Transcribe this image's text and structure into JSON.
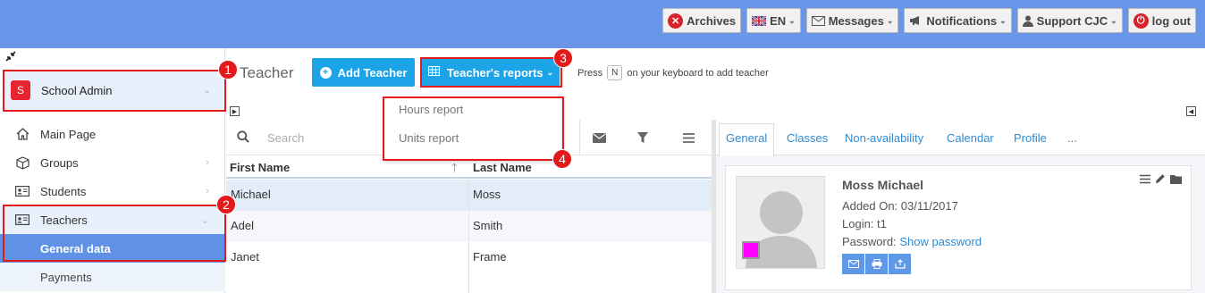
{
  "topbar": {
    "archives": "Archives",
    "language": "EN",
    "messages": "Messages",
    "notifications": "Notifications",
    "support": "Support CJC",
    "logout": "log out"
  },
  "sidebar": {
    "admin_initial": "S",
    "admin_name": "School Admin",
    "items": [
      {
        "label": "Main Page",
        "icon": "home-icon"
      },
      {
        "label": "Groups",
        "icon": "cube-icon"
      },
      {
        "label": "Students",
        "icon": "id-card-icon"
      },
      {
        "label": "Teachers",
        "icon": "id-card-icon"
      }
    ],
    "sub_items": [
      {
        "label": "General data"
      },
      {
        "label": "Payments"
      }
    ]
  },
  "header": {
    "title": "Teacher",
    "add_button": "Add Teacher",
    "reports_button": "Teacher's reports",
    "hint_prefix": "Press",
    "hint_key": "N",
    "hint_suffix": "on your keyboard to add teacher"
  },
  "dropdown": {
    "items": [
      "Hours report",
      "Units report"
    ]
  },
  "table": {
    "search_placeholder": "Search",
    "columns": [
      "First Name",
      "Last Name"
    ],
    "rows": [
      {
        "first": "Michael",
        "last": "Moss"
      },
      {
        "first": "Adel",
        "last": "Smith"
      },
      {
        "first": "Janet",
        "last": "Frame"
      }
    ]
  },
  "detail": {
    "tabs": [
      "General",
      "Classes",
      "Non-availability",
      "Calendar",
      "Profile",
      "..."
    ],
    "name": "Moss Michael",
    "added_on": "Added On: 03/11/2017",
    "login": "Login: t1",
    "password_label": "Password:",
    "password_link": "Show password",
    "color_swatch": "#ff00ff"
  },
  "annotations": [
    "1",
    "2",
    "3",
    "4"
  ],
  "colors": {
    "topbar": "#6b95e8",
    "accent": "#1ba4e8",
    "active_nav": "#5f92e4",
    "annotation": "#e41a1a"
  }
}
